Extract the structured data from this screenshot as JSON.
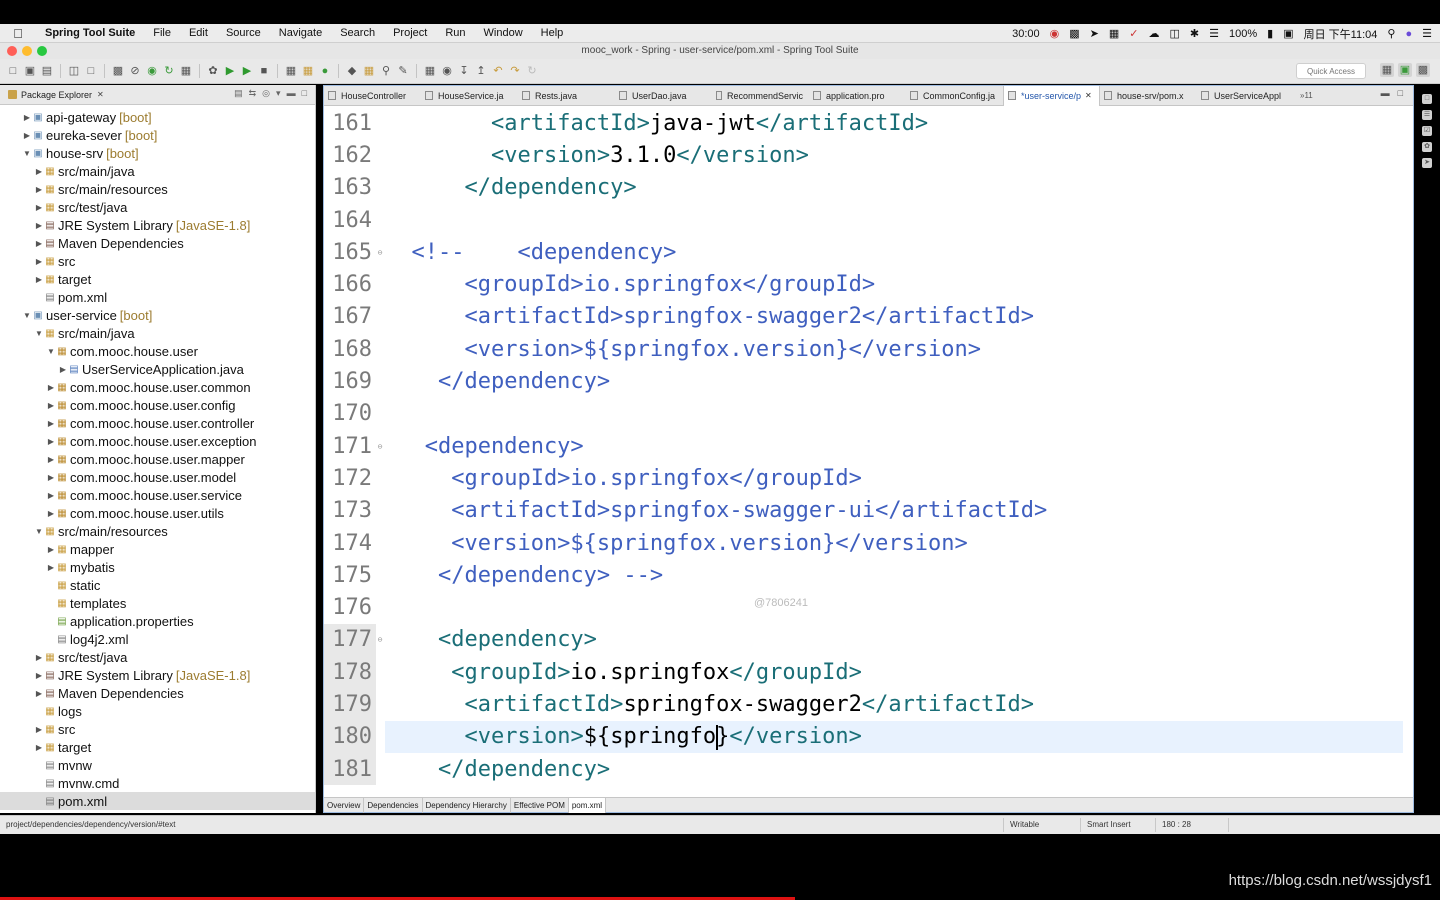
{
  "menubar": {
    "app_name": "Spring Tool Suite",
    "items": [
      "File",
      "Edit",
      "Source",
      "Navigate",
      "Search",
      "Project",
      "Run",
      "Window",
      "Help"
    ],
    "status": {
      "timer": "30:00",
      "battery": "100%",
      "clock": "周日 下午11:04"
    }
  },
  "window": {
    "title": "mooc_work - Spring - user-service/pom.xml - Spring Tool Suite"
  },
  "toolbar": {
    "quick_access_placeholder": "Quick Access"
  },
  "package_explorer": {
    "tab_label": "Package Explorer",
    "tree": [
      {
        "label": "api-gateway",
        "decoration": "[boot]",
        "level": 0,
        "icon": "project-icon",
        "expanded": false
      },
      {
        "label": "eureka-sever",
        "decoration": "[boot]",
        "level": 0,
        "icon": "project-icon",
        "expanded": false
      },
      {
        "label": "house-srv",
        "decoration": "[boot]",
        "level": 0,
        "icon": "project-icon",
        "expanded": true
      },
      {
        "label": "src/main/java",
        "decoration": "",
        "level": 1,
        "icon": "source-folder-icon",
        "expanded": false
      },
      {
        "label": "src/main/resources",
        "decoration": "",
        "level": 1,
        "icon": "source-folder-icon",
        "expanded": false
      },
      {
        "label": "src/test/java",
        "decoration": "",
        "level": 1,
        "icon": "source-folder-icon",
        "expanded": false
      },
      {
        "label": "JRE System Library",
        "decoration": "[JavaSE-1.8]",
        "level": 1,
        "icon": "library-icon",
        "expanded": false
      },
      {
        "label": "Maven Dependencies",
        "decoration": "",
        "level": 1,
        "icon": "library-icon",
        "expanded": false
      },
      {
        "label": "src",
        "decoration": "",
        "level": 1,
        "icon": "folder-icon",
        "expanded": false
      },
      {
        "label": "target",
        "decoration": "",
        "level": 1,
        "icon": "folder-icon",
        "expanded": false
      },
      {
        "label": "pom.xml",
        "decoration": "",
        "level": 1,
        "icon": "xml-file-icon",
        "leaf": true
      },
      {
        "label": "user-service",
        "decoration": "[boot]",
        "level": 0,
        "icon": "project-icon",
        "expanded": true
      },
      {
        "label": "src/main/java",
        "decoration": "",
        "level": 1,
        "icon": "source-folder-icon",
        "expanded": true
      },
      {
        "label": "com.mooc.house.user",
        "decoration": "",
        "level": 2,
        "icon": "package-icon",
        "expanded": true
      },
      {
        "label": "UserServiceApplication.java",
        "decoration": "",
        "level": 3,
        "icon": "java-file-icon",
        "expanded": false
      },
      {
        "label": "com.mooc.house.user.common",
        "decoration": "",
        "level": 2,
        "icon": "package-icon",
        "expanded": false
      },
      {
        "label": "com.mooc.house.user.config",
        "decoration": "",
        "level": 2,
        "icon": "package-icon",
        "expanded": false
      },
      {
        "label": "com.mooc.house.user.controller",
        "decoration": "",
        "level": 2,
        "icon": "package-icon",
        "expanded": false
      },
      {
        "label": "com.mooc.house.user.exception",
        "decoration": "",
        "level": 2,
        "icon": "package-icon",
        "expanded": false
      },
      {
        "label": "com.mooc.house.user.mapper",
        "decoration": "",
        "level": 2,
        "icon": "package-icon",
        "expanded": false
      },
      {
        "label": "com.mooc.house.user.model",
        "decoration": "",
        "level": 2,
        "icon": "package-icon",
        "expanded": false
      },
      {
        "label": "com.mooc.house.user.service",
        "decoration": "",
        "level": 2,
        "icon": "package-icon",
        "expanded": false
      },
      {
        "label": "com.mooc.house.user.utils",
        "decoration": "",
        "level": 2,
        "icon": "package-icon",
        "expanded": false
      },
      {
        "label": "src/main/resources",
        "decoration": "",
        "level": 1,
        "icon": "source-folder-icon",
        "expanded": true
      },
      {
        "label": "mapper",
        "decoration": "",
        "level": 2,
        "icon": "folder-icon",
        "expanded": false
      },
      {
        "label": "mybatis",
        "decoration": "",
        "level": 2,
        "icon": "folder-icon",
        "expanded": false
      },
      {
        "label": "static",
        "decoration": "",
        "level": 2,
        "icon": "folder-icon",
        "leaf": true
      },
      {
        "label": "templates",
        "decoration": "",
        "level": 2,
        "icon": "folder-icon",
        "leaf": true
      },
      {
        "label": "application.properties",
        "decoration": "",
        "level": 2,
        "icon": "properties-file-icon",
        "leaf": true
      },
      {
        "label": "log4j2.xml",
        "decoration": "",
        "level": 2,
        "icon": "xml-file-icon",
        "leaf": true
      },
      {
        "label": "src/test/java",
        "decoration": "",
        "level": 1,
        "icon": "source-folder-icon",
        "expanded": false
      },
      {
        "label": "JRE System Library",
        "decoration": "[JavaSE-1.8]",
        "level": 1,
        "icon": "library-icon",
        "expanded": false
      },
      {
        "label": "Maven Dependencies",
        "decoration": "",
        "level": 1,
        "icon": "library-icon",
        "expanded": false
      },
      {
        "label": "logs",
        "decoration": "",
        "level": 1,
        "icon": "folder-icon",
        "leaf": true
      },
      {
        "label": "src",
        "decoration": "",
        "level": 1,
        "icon": "folder-icon",
        "expanded": false
      },
      {
        "label": "target",
        "decoration": "",
        "level": 1,
        "icon": "folder-icon",
        "expanded": false
      },
      {
        "label": "mvnw",
        "decoration": "",
        "level": 1,
        "icon": "file-icon",
        "leaf": true
      },
      {
        "label": "mvnw.cmd",
        "decoration": "",
        "level": 1,
        "icon": "file-icon",
        "leaf": true
      },
      {
        "label": "pom.xml",
        "decoration": "",
        "level": 1,
        "icon": "xml-file-icon",
        "leaf": true,
        "selected": true
      }
    ]
  },
  "editor": {
    "tabs": [
      {
        "label": "HouseController",
        "active": false
      },
      {
        "label": "HouseService.ja",
        "active": false
      },
      {
        "label": "Rests.java",
        "active": false
      },
      {
        "label": "UserDao.java",
        "active": false
      },
      {
        "label": "RecommendServic",
        "active": false
      },
      {
        "label": "application.pro",
        "active": false
      },
      {
        "label": "CommonConfig.ja",
        "active": false
      },
      {
        "label": "*user-service/p",
        "active": true
      },
      {
        "label": "house-srv/pom.x",
        "active": false
      },
      {
        "label": "UserServiceAppl",
        "active": false
      }
    ],
    "more_tabs": "»11",
    "lines": [
      {
        "no": "161",
        "text": "        <artifactId>java-jwt</artifactId>",
        "kind": "xml"
      },
      {
        "no": "162",
        "text": "        <version>3.1.0</version>",
        "kind": "xml"
      },
      {
        "no": "163",
        "text": "      </dependency>",
        "kind": "xml"
      },
      {
        "no": "164",
        "text": "",
        "kind": "xml"
      },
      {
        "no": "165",
        "text": "  <!--    <dependency>",
        "kind": "comment",
        "fold": true
      },
      {
        "no": "166",
        "text": "      <groupId>io.springfox</groupId>",
        "kind": "comment"
      },
      {
        "no": "167",
        "text": "      <artifactId>springfox-swagger2</artifactId>",
        "kind": "comment"
      },
      {
        "no": "168",
        "text": "      <version>${springfox.version}</version>",
        "kind": "comment"
      },
      {
        "no": "169",
        "text": "    </dependency>",
        "kind": "comment"
      },
      {
        "no": "170",
        "text": "",
        "kind": "comment"
      },
      {
        "no": "171",
        "text": "   <dependency>",
        "kind": "comment",
        "fold": true
      },
      {
        "no": "172",
        "text": "     <groupId>io.springfox</groupId>",
        "kind": "comment"
      },
      {
        "no": "173",
        "text": "     <artifactId>springfox-swagger-ui</artifactId>",
        "kind": "comment"
      },
      {
        "no": "174",
        "text": "     <version>${springfox.version}</version>",
        "kind": "comment"
      },
      {
        "no": "175",
        "text": "    </dependency> -->",
        "kind": "comment"
      },
      {
        "no": "176",
        "text": "",
        "kind": "xml"
      },
      {
        "no": "177",
        "text": "    <dependency>",
        "kind": "xml",
        "fold": true
      },
      {
        "no": "178",
        "text": "     <groupId>io.springfox</groupId>",
        "kind": "xml"
      },
      {
        "no": "179",
        "text": "      <artifactId>springfox-swagger2</artifactId>",
        "kind": "xml"
      },
      {
        "no": "180",
        "text": "      <version>${springfo}</version>",
        "kind": "xml",
        "current": true
      },
      {
        "no": "181",
        "text": "    </dependency>",
        "kind": "xml"
      }
    ],
    "watermark": "@7806241",
    "bottom_tabs": [
      "Overview",
      "Dependencies",
      "Dependency Hierarchy",
      "Effective POM",
      "pom.xml"
    ],
    "active_bottom_tab": "pom.xml"
  },
  "statusbar": {
    "path": "project/dependencies/dependency/version/#text",
    "writable": "Writable",
    "insert_mode": "Smart Insert",
    "position": "180 : 28"
  },
  "overlay": {
    "blog_url": "https://blog.csdn.net/wssjdysf1"
  },
  "colors": {
    "tag": "#1a6e77",
    "comment": "#3f5fbf",
    "current_line": "#e8f2fe",
    "decoration": "#9c7c30"
  }
}
